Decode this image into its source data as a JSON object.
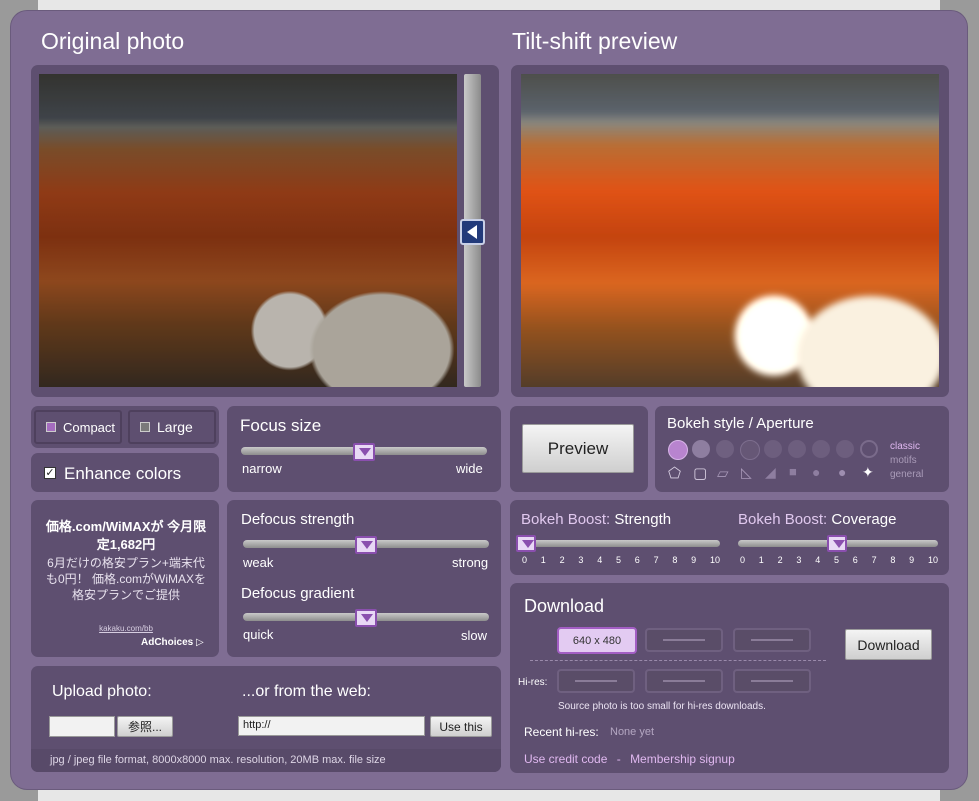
{
  "headings": {
    "original": "Original photo",
    "preview": "Tilt-shift preview"
  },
  "size_toggle": {
    "compact": "Compact",
    "large": "Large"
  },
  "enhance": {
    "label": "Enhance colors",
    "checked": true
  },
  "focus_size": {
    "title": "Focus size",
    "min_label": "narrow",
    "max_label": "wide",
    "value": 0.5
  },
  "defocus_strength": {
    "title": "Defocus strength",
    "min_label": "weak",
    "max_label": "strong",
    "value": 0.5
  },
  "defocus_gradient": {
    "title": "Defocus gradient",
    "min_label": "quick",
    "max_label": "slow",
    "value": 0.5
  },
  "preview_button": "Preview",
  "bokeh": {
    "title": "Bokeh style / Aperture",
    "categories": [
      "classic",
      "motifs",
      "general"
    ],
    "selected_category": "classic"
  },
  "boost_strength": {
    "title_prefix": "Bokeh Boost:",
    "title_name": "Strength",
    "value": 0,
    "ticks": [
      "0",
      "1",
      "2",
      "3",
      "4",
      "5",
      "6",
      "7",
      "8",
      "9",
      "10"
    ]
  },
  "boost_coverage": {
    "title_prefix": "Bokeh Boost:",
    "title_name": "Coverage",
    "value": 5,
    "ticks": [
      "0",
      "1",
      "2",
      "3",
      "4",
      "5",
      "6",
      "7",
      "8",
      "9",
      "10"
    ]
  },
  "download": {
    "title": "Download",
    "sizes": [
      "640 x 480"
    ],
    "selected": "640 x 480",
    "button": "Download",
    "hires_label": "Hi-res:",
    "hires_note": "Source photo is too small for hi-res downloads.",
    "recent_label": "Recent hi-res:",
    "recent_value": "None yet",
    "credit_link": "Use credit code",
    "separator": "-",
    "membership_link": "Membership signup"
  },
  "ad": {
    "title": "価格.com/WiMAXが 今月限定1,682円",
    "body": "6月だけの格安プラン+端末代も0円！ 価格.comがWiMAXを格安プランでご提供",
    "url": "kakaku.com/bb",
    "choices": "AdChoices ▷"
  },
  "upload": {
    "title": "Upload photo:",
    "browse": "参照...",
    "web_title": "...or from the web:",
    "url_value": "http://",
    "use_button": "Use this",
    "note": "jpg / jpeg file format, 8000x8000 max. resolution, 20MB max. file size"
  },
  "colors": {
    "frame": "#7f6d93",
    "panel": "#5e4f70",
    "accent": "#8a4fae",
    "link": "#e0b8f0"
  }
}
